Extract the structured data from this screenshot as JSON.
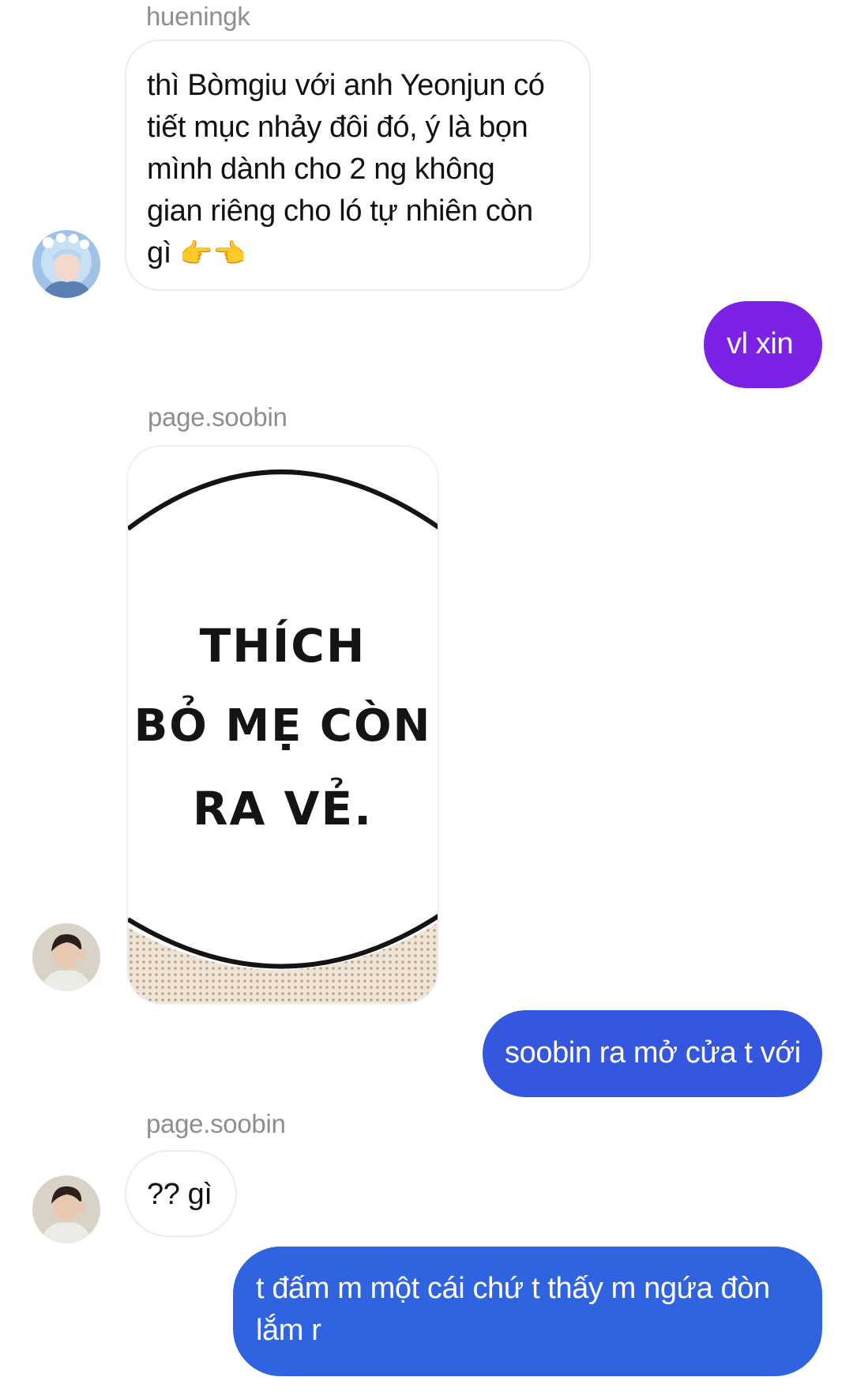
{
  "messages": [
    {
      "sender": "hueningk",
      "text": "thì Bòmgiu với anh Yeonjun có tiết mục nhảy đôi đó, ý là bọn mình dành cho 2 ng không gian riêng cho ló tự nhiên còn gì",
      "lines": [
        "thì Bòmgiu với anh Yeonjun có",
        "tiết mục nhảy đôi đó, ý là bọn",
        "mình dành cho 2 ng không",
        "gian riêng cho ló tự nhiên còn",
        "gì"
      ],
      "emoji": "👉👈"
    },
    {
      "text": "vl xin"
    },
    {
      "sender": "page.soobin",
      "sticker": {
        "lines": [
          "THÍCH",
          "BỎ MẸ CÒN",
          "RA VẺ."
        ]
      }
    },
    {
      "text": "soobin ra mở cửa t với"
    },
    {
      "sender": "page.soobin",
      "text": "?? gì"
    },
    {
      "text": "t đấm m một cái chứ t thấy m ngứa đòn lắm r",
      "lines": [
        "t đấm m một cái chứ t thấy m ngứa đòn",
        "lắm r"
      ]
    }
  ],
  "colors": {
    "outgoing_purple": "#7b22e6",
    "outgoing_blue": "#3556de",
    "outgoing_blue2": "#2f63e0",
    "incoming_border": "#ececec",
    "sender_text": "#8e8e8e"
  },
  "icons": {
    "avatar_1": "avatar-hueningk",
    "avatar_2": "avatar-soobin",
    "emoji": "pointing-fingers-emoji"
  }
}
